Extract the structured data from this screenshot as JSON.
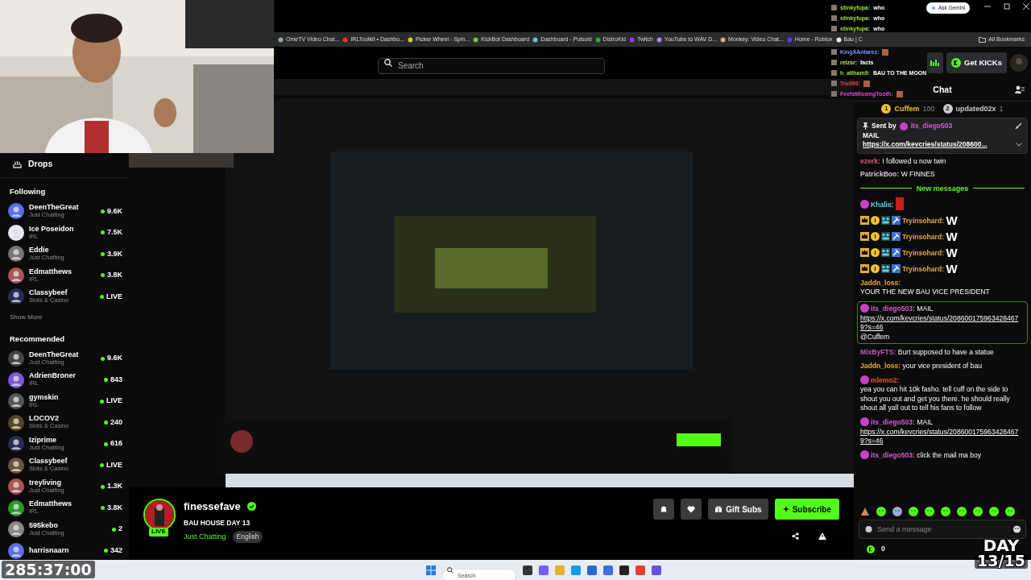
{
  "browser": {
    "gemini_button": "Ask Gemini",
    "bookmarks": [
      {
        "label": "OmeTV Video Chat..."
      },
      {
        "label": "IRLToolkit • Dashbo..."
      },
      {
        "label": "Picker Wheel - Spin..."
      },
      {
        "label": "KickBot Dashboard"
      },
      {
        "label": "Dashboard - Pulsoid"
      },
      {
        "label": "DistroKid"
      },
      {
        "label": "Twitch"
      },
      {
        "label": "YouTube to WAV D..."
      },
      {
        "label": "Monkey: Video Chat..."
      },
      {
        "label": "Home - Roblox"
      },
      {
        "label": "Bau | C"
      }
    ],
    "all_bookmarks": "All Bookmarks"
  },
  "header": {
    "search": {
      "placeholder": "Search"
    },
    "get_kicks": "Get KICKs"
  },
  "sidebar": {
    "drops": "Drops",
    "sections": [
      {
        "title": "Following",
        "items": [
          {
            "name": "DeenTheGreat",
            "category": "Just Chatting",
            "viewers": "9.6K"
          },
          {
            "name": "Ice Poseidon",
            "category": "IRL",
            "viewers": "7.5K"
          },
          {
            "name": "Eddie",
            "category": "Just Chatting",
            "viewers": "3.9K"
          },
          {
            "name": "Edmatthews",
            "category": "IRL",
            "viewers": "3.8K"
          },
          {
            "name": "Classybeef",
            "category": "Slots & Casino",
            "viewers": "LIVE"
          }
        ],
        "more": "Show More"
      },
      {
        "title": "Recommended",
        "items": [
          {
            "name": "DeenTheGreat",
            "category": "Just Chatting",
            "viewers": "9.6K"
          },
          {
            "name": "AdrienBroner",
            "category": "IRL",
            "viewers": "843"
          },
          {
            "name": "gymskin",
            "category": "IRL",
            "viewers": "LIVE"
          },
          {
            "name": "LOCOV2",
            "category": "Slots & Casino",
            "viewers": "240"
          },
          {
            "name": "Iziprime",
            "category": "Just Chatting",
            "viewers": "616"
          },
          {
            "name": "Classybeef",
            "category": "Slots & Casino",
            "viewers": "LIVE"
          },
          {
            "name": "treyliving",
            "category": "Just Chatting",
            "viewers": "1.3K"
          },
          {
            "name": "Edmatthews",
            "category": "IRL",
            "viewers": "3.8K"
          },
          {
            "name": "595kebo",
            "category": "Just Chatting",
            "viewers": "2"
          },
          {
            "name": "harrisnaarn",
            "viewers": "342"
          }
        ]
      }
    ]
  },
  "channel": {
    "name": "finessefave",
    "live_badge": "LIVE",
    "title": "BAU HOUSE DAY 13",
    "category": "Just Chatting",
    "tag": "English",
    "gift_button": "Gift Subs",
    "subscribe_button": "Subscribe"
  },
  "chat": {
    "title": "Chat",
    "leaderboard": [
      {
        "rank": "1",
        "name": "Cuffem",
        "count": "100",
        "color": "#f2c230"
      },
      {
        "rank": "2",
        "name": "updated02x",
        "count": "1",
        "color": "#c9c9c9"
      }
    ],
    "pinned": {
      "label": "Sent by",
      "user": "its_diego503",
      "text": "MAIL",
      "link": "https://x.com/kevcries/status/208600..."
    },
    "messages": [
      {
        "kind": "chat",
        "user": "ezerk:",
        "color": "#e0567a",
        "text": "I followed u now twin",
        "subscriber": false,
        "role_badges": false,
        "highlighted": false
      },
      {
        "kind": "chat",
        "user": "PatrickBoo:",
        "color": "#d8c3d8",
        "text": "W FINNES",
        "subscriber": false,
        "role_badges": false,
        "highlighted": false
      },
      {
        "kind": "divider",
        "text": "New messages"
      },
      {
        "kind": "image_emote",
        "user": "Khalis:",
        "color": "#5ed4e8",
        "subscriber": true,
        "role_badges": false,
        "highlighted": false
      },
      {
        "kind": "emote",
        "user": "Tryinsohard:",
        "color": "#e8a93a",
        "text": "W",
        "subscriber": false,
        "role_badges": true,
        "highlighted": false
      },
      {
        "kind": "emote",
        "user": "Tryinsohard:",
        "color": "#e8a93a",
        "text": "W",
        "subscriber": false,
        "role_badges": true,
        "highlighted": false
      },
      {
        "kind": "emote",
        "user": "Tryinsohard:",
        "color": "#e8a93a",
        "text": "W",
        "subscriber": false,
        "role_badges": true,
        "highlighted": false
      },
      {
        "kind": "emote",
        "user": "Tryinsohard:",
        "color": "#e8a93a",
        "text": "W",
        "subscriber": false,
        "role_badges": true,
        "highlighted": false
      },
      {
        "kind": "chat",
        "user": "Jaddn_loss:",
        "color": "#e8a93a",
        "text": "YOUR THE NEW BAU VICE PRESIDENT",
        "subscriber": false,
        "role_badges": false,
        "highlighted": false
      },
      {
        "kind": "chat",
        "user": "its_diego503:",
        "color": "#d65bd6",
        "text": "MAIL",
        "link": "https://x.com/kevcries/status/2086001759634284679?s=46",
        "after": "@Cuffem",
        "subscriber": true,
        "role_badges": false,
        "highlighted": true
      },
      {
        "kind": "chat",
        "user": "MixByFTS:",
        "color": "#c455c4",
        "text": "Burt supposed to have a statue",
        "subscriber": false,
        "role_badges": false,
        "highlighted": false
      },
      {
        "kind": "chat",
        "user": "Jaddn_loss:",
        "color": "#e8a93a",
        "text": "your vice president of bau",
        "subscriber": false,
        "role_badges": false,
        "highlighted": false
      },
      {
        "kind": "chat",
        "user": "mlemo2:",
        "color": "#e05a3a",
        "text": "yea you can hit 10k fasho. tell cuff on the side to shout you out and get you there. he should really shout all yall out to tell his fans to follow",
        "subscriber": true,
        "role_badges": false,
        "highlighted": false
      },
      {
        "kind": "chat",
        "user": "its_diego503:",
        "color": "#d65bd6",
        "text": "MAIL",
        "link": "https://x.com/kevcries/status/2086001759634284679?s=46",
        "subscriber": true,
        "role_badges": false,
        "highlighted": false
      },
      {
        "kind": "chat",
        "user": "its_diego503:",
        "color": "#d65bd6",
        "text": "click the mail ma boy",
        "subscriber": true,
        "role_badges": false,
        "highlighted": false
      }
    ],
    "input": {
      "placeholder": "Send a message"
    },
    "kicks": "0"
  },
  "overlay_chat": [
    {
      "kind": "text",
      "user": "stinkyfupa:",
      "color": "#9be03a",
      "text": "who"
    },
    {
      "kind": "text",
      "user": "stinkyfupa:",
      "color": "#9be03a",
      "text": "who"
    },
    {
      "kind": "text",
      "user": "stinkyfupa:",
      "color": "#9be03a",
      "text": "who"
    },
    {
      "kind": "emote",
      "user": "KingXAntarez:",
      "color": "#7a94ff"
    },
    {
      "kind": "text",
      "user": "relzsr:",
      "color": "#b6f05a",
      "text": "facts"
    },
    {
      "kind": "text",
      "user": "h_altham9:",
      "color": "#9be03a",
      "text": "BAU TO THE MOON"
    },
    {
      "kind": "emote",
      "user": "Tru998:",
      "color": "#f03a5a"
    },
    {
      "kind": "emote",
      "user": "FeefsMissingTooth:",
      "color": "#e04ad8"
    }
  ],
  "stream_overlay": {
    "timer": "285:37:00",
    "day": "DAY",
    "day_count": "13/15"
  },
  "taskbar": {
    "search": {
      "placeholder": "Search"
    }
  }
}
